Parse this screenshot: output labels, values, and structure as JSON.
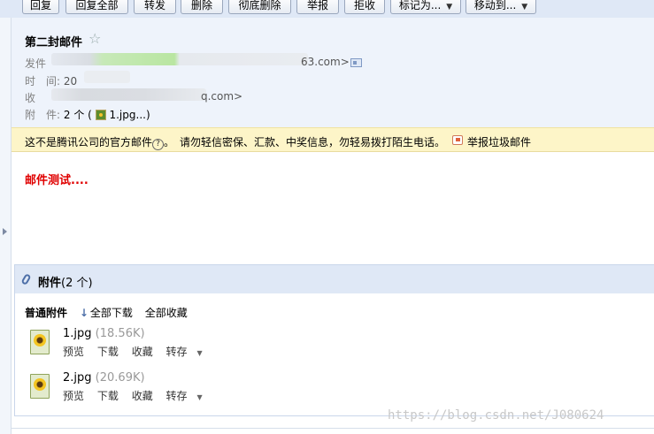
{
  "toolbar": {
    "buttons": [
      "回复",
      "回复全部",
      "转发",
      "删除",
      "彻底删除",
      "举报",
      "拒收",
      "标记为...",
      "移动到..."
    ]
  },
  "header": {
    "subject": "第二封邮件",
    "star": "☆",
    "from_label": "发件",
    "from_value": "63.com>",
    "time_label": "时　间:",
    "time_value": "20",
    "to_label": "收",
    "to_value": "q.com>",
    "attach_label": "附　件:",
    "attach_count": "2 个 (",
    "attach_file": "1.jpg...)"
  },
  "warning": {
    "part1": "这不是腾讯公司的官方邮件",
    "part2": "。　请勿轻信密保、汇款、中奖信息，勿轻易拨打陌生电话。",
    "report": "举报垃圾邮件"
  },
  "mail_body": "邮件测试....",
  "attachments": {
    "title_bold": "附件",
    "title_count": "(2 个)",
    "section_label": "普通附件",
    "download_all": "全部下载",
    "save_all": "全部收藏",
    "files": [
      {
        "name": "1.jpg",
        "size": "(18.56K)",
        "preview": "预览",
        "download": "下载",
        "save": "收藏",
        "forward": "转存"
      },
      {
        "name": "2.jpg",
        "size": "(20.69K)",
        "preview": "预览",
        "download": "下载",
        "save": "收藏",
        "forward": "转存"
      }
    ]
  },
  "watermark": "https://blog.csdn.net/J080624"
}
